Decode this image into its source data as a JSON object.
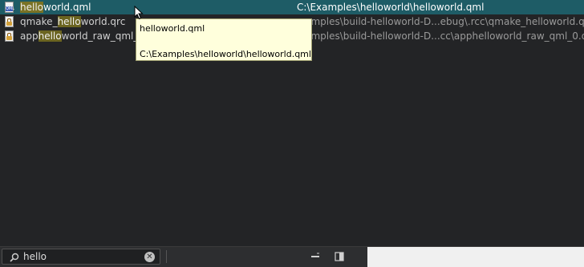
{
  "results": [
    {
      "name_before": "",
      "name_match": "hello",
      "name_after": "world.qml",
      "path": "C:\\Examples\\helloworld\\helloworld.qml",
      "icon": "qml-file-icon",
      "selected": true
    },
    {
      "name_before": "qmake_",
      "name_match": "hello",
      "name_after": "world.qrc",
      "path": "xamples\\build-helloworld-D...ebug\\.rcc\\qmake_helloworld.qrc",
      "icon": "locked-file-icon",
      "selected": false
    },
    {
      "name_before": "app",
      "name_match": "hello",
      "name_after": "world_raw_qml_0.",
      "path": "xamples\\build-helloworld-D...cc\\apphelloworld_raw_qml_0.qrc",
      "icon": "locked-file-icon",
      "selected": false
    }
  ],
  "tooltip": {
    "title": "helloworld.qml",
    "path": "C:\\Examples\\helloworld\\helloworld.qml"
  },
  "search": {
    "value": "hello"
  },
  "colors": {
    "selection": "#1e5c66",
    "match_highlight": "#6b6420",
    "tooltip_bg": "#ffffdc",
    "background": "#232426"
  },
  "icons": [
    "qml-file-icon",
    "locked-file-icon",
    "search-icon",
    "clear-icon",
    "minus-icon",
    "sidebar-toggle-icon",
    "mouse-cursor-icon"
  ]
}
